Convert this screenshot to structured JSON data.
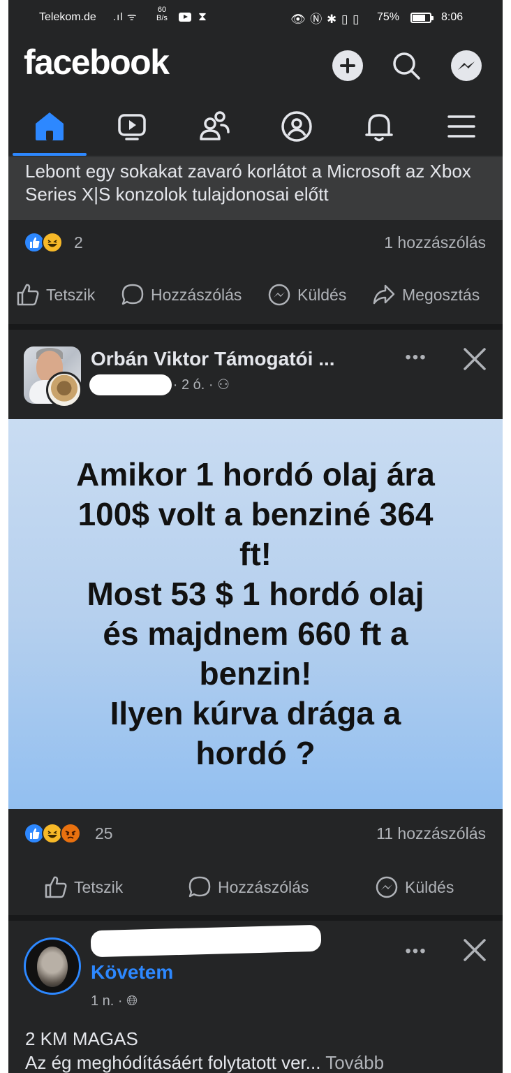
{
  "status_bar": {
    "carrier": "Telekom.de",
    "net_speed_value": "60",
    "net_speed_unit": "B/s",
    "battery": "75%",
    "battery_level": 0.75,
    "time": "8:06"
  },
  "header": {
    "logo": "facebook",
    "icons": [
      "plus-icon",
      "search-icon",
      "messenger-icon"
    ]
  },
  "tabs": [
    {
      "name": "home",
      "icon": "home-icon",
      "active": true
    },
    {
      "name": "video",
      "icon": "video-icon",
      "active": false
    },
    {
      "name": "friends",
      "icon": "friends-icon",
      "active": false
    },
    {
      "name": "profile",
      "icon": "profile-icon",
      "active": false
    },
    {
      "name": "notifications",
      "icon": "bell-icon",
      "active": false
    },
    {
      "name": "menu",
      "icon": "menu-icon",
      "active": false
    }
  ],
  "article": {
    "title": "Lebont egy sokakat zavaró korlátot a Microsoft az Xbox Series X|S konzolok tulajdonosai előtt"
  },
  "post1": {
    "reaction_count": "2",
    "comment_count": "1 hozzászólás",
    "actions": {
      "like": "Tetszik",
      "comment": "Hozzászólás",
      "send": "Küldés",
      "share": "Megosztás"
    }
  },
  "post2": {
    "page_name": "Orbán Viktor Támogatói ...",
    "author_visible": "n",
    "time": "· 2 ó. ·",
    "image_text": [
      "Amikor 1 hordó olaj ára",
      "100$ volt a benziné 364",
      "ft!",
      "Most 53 $ 1 hordó olaj",
      "és majdnem 660 ft a",
      "benzin!",
      "Ilyen kúrva drága a",
      "hordó ?"
    ],
    "reaction_count": "25",
    "comment_count": "11 hozzászólás",
    "actions": {
      "like": "Tetszik",
      "comment": "Hozzászólás",
      "send": "Küldés"
    }
  },
  "post3": {
    "follow_label": "Követem",
    "time": "1 n. ·",
    "text_line1": "2 KM MAGAS",
    "text_line2": "Az ég meghódításáért folytatott ver...",
    "more_label": "Tovább"
  },
  "colors": {
    "background": "#242526",
    "separator": "#18191a",
    "accent": "#2d88ff",
    "secondary_text": "#b0b3b8"
  }
}
